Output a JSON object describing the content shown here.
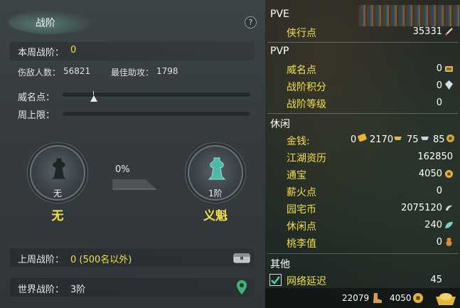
{
  "left": {
    "title": "战阶",
    "help_label": "?",
    "weekly_rank_label": "本周战阶：",
    "weekly_rank_value": "0",
    "kills_label": "伤敌人数：",
    "kills_value": "56821",
    "assist_label": "最佳助攻：",
    "assist_value": "1798",
    "prestige_label": "威名点：",
    "weekly_cap_label": "周上限：",
    "current_emblem": {
      "tier_label": "无",
      "name": "无"
    },
    "progress_percent": "0%",
    "next_emblem": {
      "tier_label": "1阶",
      "name": "义魁"
    },
    "last_week_label": "上周战阶：",
    "last_week_value": "0 (500名以外)",
    "world_label": "世界战阶：",
    "world_value": "3阶"
  },
  "right": {
    "pve": {
      "title": "PVE",
      "items": [
        {
          "label": "侠行点",
          "value": "35331",
          "icon": "sword-icon"
        }
      ]
    },
    "pvp": {
      "title": "PVP",
      "items": [
        {
          "label": "威名点",
          "value": "0",
          "icon": "scroll-icon"
        },
        {
          "label": "战阶积分",
          "value": "0",
          "icon": "crystal-icon"
        },
        {
          "label": "战阶等级",
          "value": "0",
          "icon": ""
        }
      ]
    },
    "leisure": {
      "title": "休闲",
      "money_label": "金钱:",
      "money_gold": "0",
      "money_silver_ingot": "2170",
      "money_silver": "75",
      "money_copper": "85",
      "items": [
        {
          "label": "江湖资历",
          "value": "162850",
          "icon": ""
        },
        {
          "label": "通宝",
          "value": "4050",
          "icon": "coin-icon"
        },
        {
          "label": "薪火点",
          "value": "0",
          "icon": ""
        },
        {
          "label": "园宅币",
          "value": "2075120",
          "icon": "garden-coin-icon"
        },
        {
          "label": "休闲点",
          "value": "240",
          "icon": "leaf-icon"
        },
        {
          "label": "桃李值",
          "value": "0",
          "icon": "gourd-icon"
        }
      ]
    },
    "other": {
      "title": "其他",
      "latency_label": "网络延迟",
      "latency_value": "45",
      "latency_checked": true
    },
    "footer": {
      "value_a": "22079",
      "value_b": "4050"
    }
  },
  "colors": {
    "accent_yellow": "#f2e04a",
    "panel_dark": "#353b3f",
    "jade": "#4fb8a6"
  }
}
